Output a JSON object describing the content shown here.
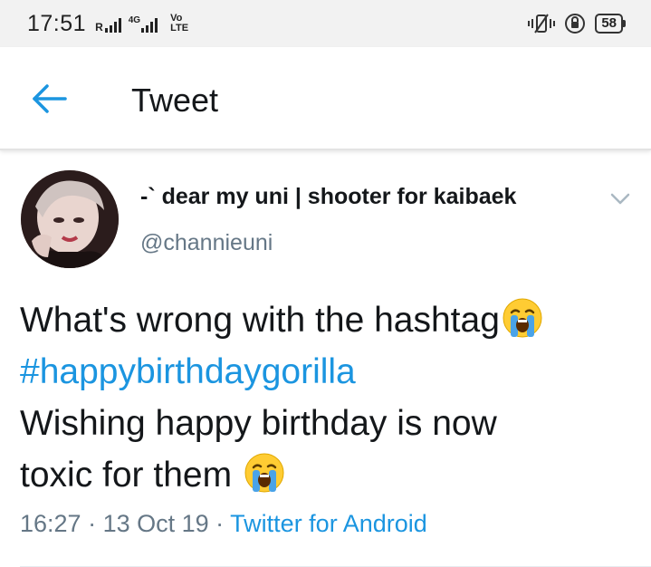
{
  "status_bar": {
    "time": "17:51",
    "roaming": "R",
    "network": "4G",
    "volte_top": "Vo",
    "volte_bottom": "LTE",
    "battery": "58"
  },
  "header": {
    "title": "Tweet",
    "back_icon": "arrow-left-icon"
  },
  "tweet": {
    "display_name": "-` dear my uni | shooter for kaibaek",
    "handle": "@channieuni",
    "text_line1": "What's wrong with the hashtag",
    "hashtag": "#happybirthdaygorilla",
    "text_line3": "Wishing happy birthday is now",
    "text_line4": "toxic for them ",
    "emoji": "loudly-crying-face",
    "time": "16:27",
    "date": "13 Oct 19",
    "separator": " · ",
    "source": "Twitter for Android"
  },
  "colors": {
    "link": "#1b95e0",
    "secondary_text": "#657786",
    "primary_text": "#14171a"
  }
}
